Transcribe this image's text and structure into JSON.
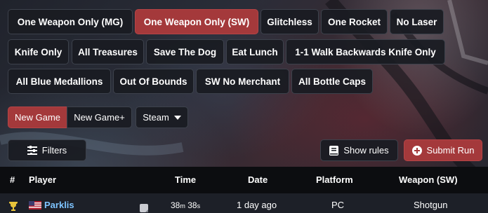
{
  "categories": {
    "row1": [
      "One Weapon Only (MG)",
      "One Weapon Only (SW)",
      "Glitchless",
      "One Rocket",
      "No Laser"
    ],
    "row2": [
      "Knife Only",
      "All Treasures",
      "Save The Dog",
      "Eat Lunch",
      "1-1 Walk Backwards Knife Only"
    ],
    "row3": [
      "All Blue Medallions",
      "Out Of Bounds",
      "SW No Merchant",
      "All Bottle Caps"
    ],
    "active": "One Weapon Only (SW)"
  },
  "game_mode": {
    "options": [
      "New Game",
      "New Game+"
    ],
    "active": "New Game"
  },
  "platform_select": {
    "value": "Steam"
  },
  "toolbar": {
    "filters_label": "Filters",
    "show_rules_label": "Show rules",
    "submit_run_label": "Submit Run"
  },
  "table": {
    "columns": {
      "rank": "#",
      "player": "Player",
      "time": "Time",
      "date": "Date",
      "platform": "Platform",
      "weapon": "Weapon (SW)"
    },
    "rows": [
      {
        "rank": "1",
        "player": "Parklis",
        "time_m": "38",
        "time_m_unit": "m",
        "time_s": "38",
        "time_s_unit": "s",
        "date": "1 day ago",
        "platform": "PC",
        "weapon": "Shotgun"
      }
    ]
  },
  "colors": {
    "accent": "#a4393b",
    "trophy": "#e8c33a",
    "player_link": "#7ec4ff"
  }
}
